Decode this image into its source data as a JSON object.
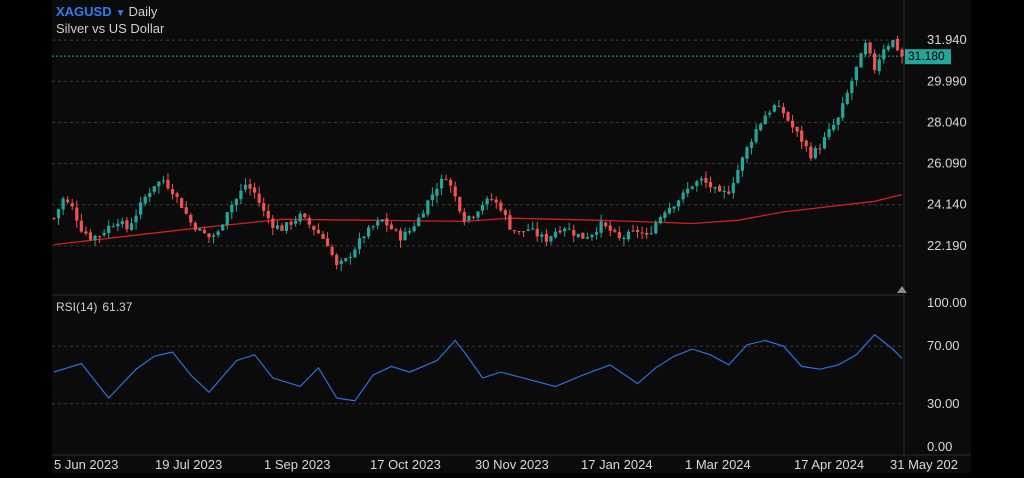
{
  "header": {
    "symbol": "XAGUSD",
    "interval": "Daily",
    "description": "Silver vs US Dollar"
  },
  "last_price_badge": "31.180",
  "rsi": {
    "label": "RSI(14)",
    "value": "61.37"
  },
  "colors": {
    "background": "#0b0b0b",
    "up": "#26a69a",
    "down": "#ef5350",
    "moving_average": "#d11f1f",
    "rsi_line": "#2f6fdc",
    "grid": "#3a3a3a",
    "symbol": "#2f7df6"
  },
  "chart_data": [
    {
      "type": "candlestick",
      "price_axis_ticks": [
        "31.940",
        "29.990",
        "28.040",
        "26.090",
        "24.140",
        "22.190"
      ],
      "time_axis_ticks": [
        "5 Jun 2023",
        "19 Jul 2023",
        "1 Sep 2023",
        "17 Oct 2023",
        "30 Nov 2023",
        "17 Jan 2024",
        "1 Mar 2024",
        "17 Apr 2024",
        "31 May 202"
      ],
      "ylim": [
        20.5,
        32.9
      ],
      "grid": "dashed horizontal",
      "close_path": [
        [
          0,
          23.5
        ],
        [
          2,
          24.4
        ],
        [
          4,
          24.0
        ],
        [
          6,
          23.0
        ],
        [
          8,
          22.6
        ],
        [
          10,
          22.7
        ],
        [
          12,
          23.1
        ],
        [
          14,
          23.4
        ],
        [
          16,
          23.0
        ],
        [
          18,
          23.7
        ],
        [
          20,
          24.5
        ],
        [
          22,
          25.1
        ],
        [
          24,
          25.3
        ],
        [
          26,
          24.8
        ],
        [
          28,
          24.1
        ],
        [
          30,
          23.3
        ],
        [
          32,
          22.9
        ],
        [
          34,
          22.6
        ],
        [
          36,
          22.8
        ],
        [
          38,
          23.9
        ],
        [
          40,
          24.4
        ],
        [
          42,
          25.1
        ],
        [
          44,
          24.7
        ],
        [
          46,
          23.8
        ],
        [
          48,
          23.2
        ],
        [
          50,
          23.0
        ],
        [
          52,
          23.3
        ],
        [
          54,
          23.6
        ],
        [
          56,
          23.2
        ],
        [
          58,
          22.8
        ],
        [
          60,
          22.3
        ],
        [
          62,
          21.2
        ],
        [
          64,
          21.5
        ],
        [
          66,
          22.1
        ],
        [
          68,
          22.7
        ],
        [
          70,
          23.1
        ],
        [
          72,
          23.4
        ],
        [
          74,
          23.0
        ],
        [
          76,
          22.6
        ],
        [
          78,
          22.9
        ],
        [
          80,
          23.5
        ],
        [
          82,
          24.3
        ],
        [
          84,
          25.0
        ],
        [
          86,
          25.5
        ],
        [
          88,
          24.5
        ],
        [
          90,
          23.5
        ],
        [
          92,
          23.7
        ],
        [
          94,
          24.2
        ],
        [
          96,
          24.4
        ],
        [
          98,
          24.0
        ],
        [
          100,
          23.1
        ],
        [
          102,
          22.8
        ],
        [
          104,
          23.0
        ],
        [
          106,
          22.7
        ],
        [
          108,
          22.5
        ],
        [
          110,
          22.9
        ],
        [
          112,
          23.1
        ],
        [
          114,
          22.8
        ],
        [
          116,
          22.6
        ],
        [
          118,
          22.8
        ],
        [
          120,
          23.2
        ],
        [
          122,
          22.9
        ],
        [
          124,
          22.5
        ],
        [
          126,
          22.7
        ],
        [
          128,
          22.9
        ],
        [
          130,
          22.6
        ],
        [
          132,
          23.3
        ],
        [
          134,
          23.9
        ],
        [
          136,
          24.2
        ],
        [
          138,
          24.6
        ],
        [
          140,
          25.1
        ],
        [
          142,
          25.3
        ],
        [
          144,
          25.0
        ],
        [
          146,
          24.6
        ],
        [
          148,
          24.8
        ],
        [
          150,
          25.8
        ],
        [
          152,
          26.8
        ],
        [
          154,
          27.7
        ],
        [
          156,
          28.4
        ],
        [
          158,
          28.8
        ],
        [
          160,
          28.5
        ],
        [
          162,
          27.8
        ],
        [
          164,
          27.2
        ],
        [
          166,
          26.5
        ],
        [
          168,
          26.9
        ],
        [
          170,
          27.6
        ],
        [
          172,
          28.2
        ],
        [
          174,
          29.4
        ],
        [
          176,
          30.6
        ],
        [
          178,
          31.7
        ],
        [
          180,
          30.6
        ],
        [
          182,
          31.6
        ],
        [
          184,
          31.9
        ],
        [
          186,
          31.18
        ]
      ],
      "moving_average": [
        [
          0,
          22.25
        ],
        [
          30,
          23.0
        ],
        [
          50,
          23.45
        ],
        [
          70,
          23.4
        ],
        [
          90,
          23.35
        ],
        [
          100,
          23.5
        ],
        [
          120,
          23.4
        ],
        [
          140,
          23.25
        ],
        [
          150,
          23.4
        ],
        [
          160,
          23.8
        ],
        [
          170,
          24.05
        ],
        [
          180,
          24.3
        ],
        [
          186,
          24.62
        ]
      ]
    },
    {
      "type": "line",
      "name": "RSI(14)",
      "ticks": [
        "100.00",
        "70.00",
        "30.00",
        "0.00"
      ],
      "ylim": [
        0,
        100
      ],
      "x": [
        0,
        6,
        12,
        18,
        22,
        26,
        30,
        34,
        40,
        44,
        48,
        54,
        58,
        62,
        66,
        70,
        74,
        78,
        84,
        88,
        90,
        94,
        98,
        104,
        110,
        116,
        122,
        128,
        132,
        136,
        140,
        144,
        148,
        152,
        156,
        160,
        164,
        168,
        172,
        176,
        180,
        184,
        186
      ],
      "values": [
        52,
        58,
        34,
        54,
        63,
        66,
        50,
        38,
        60,
        64,
        48,
        42,
        55,
        34,
        32,
        50,
        56,
        52,
        60,
        74,
        66,
        48,
        52,
        47,
        42,
        50,
        57,
        44,
        55,
        63,
        68,
        64,
        57,
        71,
        74,
        70,
        56,
        54,
        57,
        64,
        78,
        68,
        61.37
      ]
    }
  ]
}
